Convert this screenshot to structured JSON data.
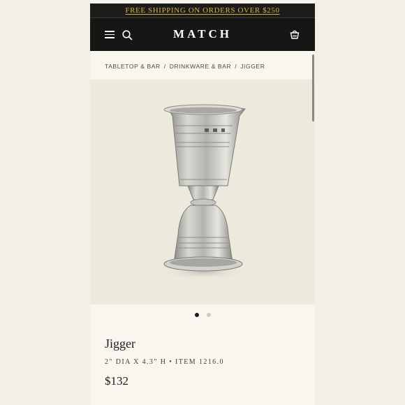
{
  "promo_banner": {
    "text": "FREE SHIPPING ON ORDERS OVER $250",
    "color": "#d8b24a"
  },
  "header": {
    "logo": "MATCH",
    "icons": [
      "menu-icon",
      "search-icon",
      "bag-icon"
    ],
    "background": "#161614"
  },
  "breadcrumb": {
    "items": [
      "TABLETOP & BAR",
      "DRINKWARE & BAR",
      "JIGGER"
    ],
    "separator": "/"
  },
  "gallery": {
    "image": "jigger-photo",
    "slide_count": 2,
    "current_slide": 1
  },
  "product": {
    "title": "Jigger",
    "spec": "2\" DIA X 4.3\" H • ITEM 1216.0",
    "price": "$132"
  }
}
